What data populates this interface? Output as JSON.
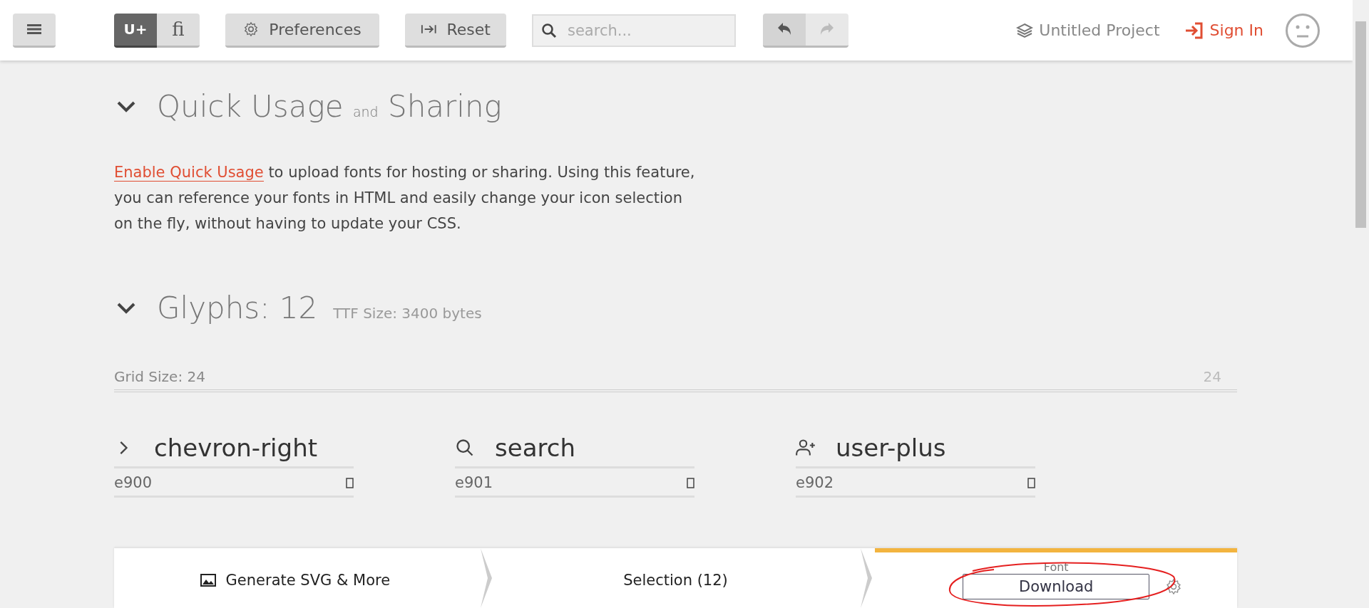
{
  "toolbar": {
    "mode_tabs": [
      {
        "label": "U+",
        "selected": true
      },
      {
        "label": "fi",
        "selected": false
      }
    ],
    "preferences": "Preferences",
    "reset": "Reset",
    "search": {
      "placeholder": "search..."
    },
    "undo": {
      "disabled": false
    },
    "redo": {
      "disabled": true
    },
    "project": "Untitled Project",
    "sign_in": "Sign In"
  },
  "quick_usage": {
    "expanded": true,
    "title": "Quick Usage",
    "title_small": "and",
    "title_end": "Sharing",
    "link": "Enable Quick Usage",
    "text": "to upload fonts for hosting or sharing. Using this feature, you can reference your fonts in HTML and easily change your icon selection on the fly, without having to update your CSS."
  },
  "glyphs": {
    "expanded": true,
    "title": "Glyphs: 12",
    "ttf_size": "TTF Size: 3400 bytes",
    "grid_label": "Grid Size: 24",
    "grid_value": "24",
    "items": [
      {
        "kind": "chevron",
        "name": "chevron-right",
        "code": "e900"
      },
      {
        "kind": "search",
        "name": "search",
        "code": "e901"
      },
      {
        "kind": "user-plus",
        "name": "user-plus",
        "code": "e902"
      }
    ]
  },
  "bottom_bar": {
    "sections": [
      {
        "kind": "generate",
        "label": "Generate SVG & More",
        "selected": false
      },
      {
        "kind": "selection",
        "label": "Selection (12)",
        "selected": false
      },
      {
        "kind": "font",
        "label": "Font",
        "button": "Download",
        "selected": true
      }
    ]
  }
}
